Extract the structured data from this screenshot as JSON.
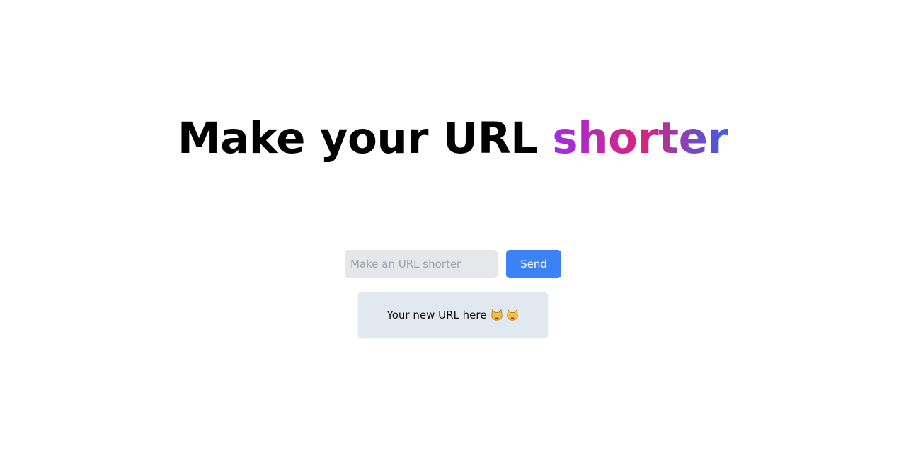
{
  "header": {
    "title_main": "Make your URL ",
    "title_accent": "shorter",
    "accent_gradient": [
      "#9c2ee6",
      "#d8247e",
      "#3b5ee6"
    ]
  },
  "form": {
    "input_placeholder": "Make an URL shorter",
    "input_value": "",
    "send_label": "Send",
    "send_color": "#3b82f6"
  },
  "result": {
    "text": "Your new URL here",
    "icons": [
      "cat-face-icon",
      "cat-face-icon"
    ]
  }
}
